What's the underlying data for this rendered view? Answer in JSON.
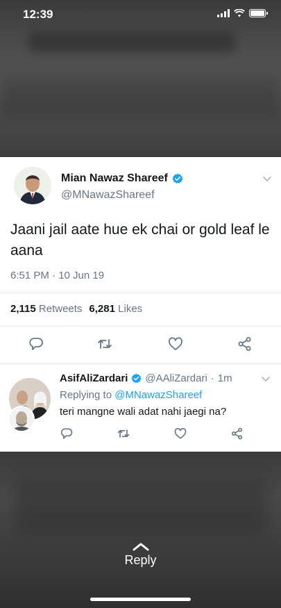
{
  "status_bar": {
    "time": "12:39"
  },
  "tweet": {
    "author_name": "Mian Nawaz Shareef",
    "author_handle": "@MNawazShareef",
    "text": "Jaani jail aate hue ek chai or gold leaf le aana",
    "time": "6:51 PM · 10 Jun 19",
    "retweets_count": "2,115",
    "retweets_label": "Retweets",
    "likes_count": "6,281",
    "likes_label": "Likes"
  },
  "reply": {
    "author_name": "AsifAliZardari",
    "author_handle": "@AAliZardari",
    "separator": "·",
    "age": "1m",
    "replying_prefix": "Replying to",
    "replying_to": "@MNawazShareef",
    "text": "teri mangne wali adat nahi jaegi na?"
  },
  "footer": {
    "reply_label": "Reply"
  },
  "colors": {
    "accent": "#1da1f2",
    "text": "#14171a",
    "muted": "#657786"
  }
}
